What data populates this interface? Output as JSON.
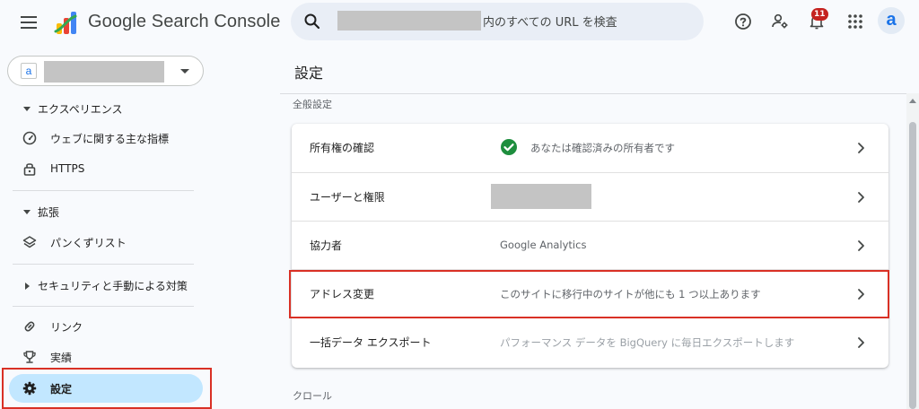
{
  "header": {
    "brand": "Google Search Console",
    "search_placeholder": "内のすべての URL を検査",
    "notification_count": "11",
    "avatar_letter": "a"
  },
  "sidebar": {
    "property_letter": "a",
    "groups": {
      "experience": "エクスペリエンス",
      "enhancements": "拡張",
      "security": "セキュリティと手動による対策"
    },
    "items": {
      "core_web_vitals": "ウェブに関する主な指標",
      "https": "HTTPS",
      "breadcrumbs": "パンくずリスト",
      "links": "リンク",
      "achievements": "実績",
      "settings": "設定"
    }
  },
  "main": {
    "title": "設定",
    "section_general": "全般設定",
    "section_crawl": "クロール",
    "rows": [
      {
        "label": "所有権の確認",
        "value": "あなたは確認済みの所有者です"
      },
      {
        "label": "ユーザーと権限",
        "value": ""
      },
      {
        "label": "協力者",
        "value": "Google Analytics"
      },
      {
        "label": "アドレス変更",
        "value": "このサイトに移行中のサイトが他にも 1 つ以上あります"
      },
      {
        "label": "一括データ エクスポート",
        "value": "パフォーマンス データを BigQuery に毎日エクスポートします"
      }
    ]
  },
  "colors": {
    "accent": "#1a73e8",
    "active_bg": "#c2e7ff",
    "highlight": "#d93025",
    "success": "#1e8e3e"
  }
}
